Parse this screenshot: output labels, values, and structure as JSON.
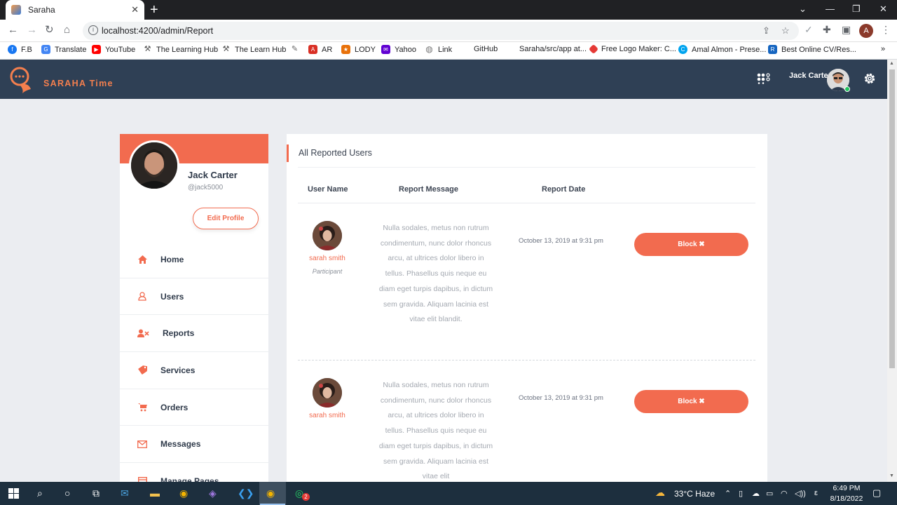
{
  "browser": {
    "tab_title": "Saraha",
    "url": "localhost:4200/admin/Report",
    "profile_initial": "A",
    "bookmarks": [
      "F.B",
      "Translate",
      "YouTube",
      "The Learning Hub",
      "The Learn Hub",
      "",
      "AR",
      "LODY",
      "Yahoo",
      "Link",
      "GitHub",
      "Saraha/src/app at...",
      "Free Logo Maker: C...",
      "Amal Almon - Prese...",
      "Best Online CV/Res..."
    ],
    "more": "»"
  },
  "app": {
    "logo_text": "SARAHA Time",
    "user_name": "Jack Carter"
  },
  "profile": {
    "name": "Jack Carter",
    "username": "@jack5000",
    "edit_label": "Edit Profile"
  },
  "menu": [
    {
      "label": "Home",
      "icon": "home-icon"
    },
    {
      "label": "Users",
      "icon": "user-icon"
    },
    {
      "label": "Reports",
      "icon": "user-times-icon"
    },
    {
      "label": "Services",
      "icon": "tag-icon"
    },
    {
      "label": "Orders",
      "icon": "cart-icon"
    },
    {
      "label": "Messages",
      "icon": "envelope-icon"
    },
    {
      "label": "Manage Pages",
      "icon": "table-icon"
    }
  ],
  "reports": {
    "title": "All Reported Users",
    "headers": {
      "user": "User Name",
      "message": "Report Message",
      "date": "Report Date"
    },
    "rows": [
      {
        "name": "sarah smith",
        "role": "Participant",
        "message": "Nulla sodales, metus non rutrum condimentum, nunc dolor rhoncus arcu, at ultrices dolor libero in tellus. Phasellus quis neque eu diam eget turpis dapibus, in dictum sem gravida. Aliquam lacinia est vitae elit blandit.",
        "date": "October 13, 2019 at 9:31 pm",
        "action": "Block ✖"
      },
      {
        "name": "sarah smith",
        "role": "",
        "message": "Nulla sodales, metus non rutrum condimentum, nunc dolor rhoncus arcu, at ultrices dolor libero in tellus. Phasellus quis neque eu diam eget turpis dapibus, in dictum sem gravida. Aliquam lacinia est vitae elit",
        "date": "October 13, 2019 at 9:31 pm",
        "action": "Block ✖"
      }
    ]
  },
  "taskbar": {
    "weather": "33°C  Haze",
    "lang": "ε",
    "time": "6:49 PM",
    "date": "8/18/2022",
    "badge": "2"
  },
  "colors": {
    "accent": "#f26b4f",
    "header": "#2f4055",
    "background": "#ebedf1"
  }
}
